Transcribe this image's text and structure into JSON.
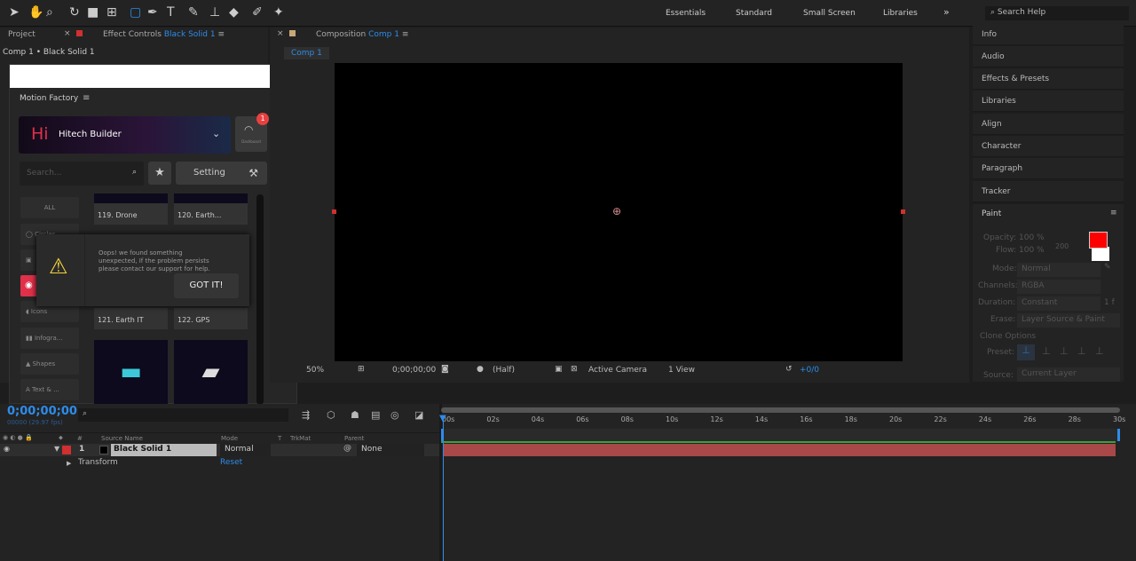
{
  "toolbar": {
    "workspaces": [
      "Essentials",
      "Standard",
      "Small Screen",
      "Libraries"
    ],
    "search_placeholder": "Search Help",
    "more": "»"
  },
  "left_panel": {
    "tab_project": "Project",
    "tab_effect_controls": "Effect Controls",
    "effect_target": "Black Solid 1",
    "breadcrumb": "Comp 1 • Black Solid 1"
  },
  "comp_panel": {
    "tab_label": "Composition",
    "comp_name": "Comp 1",
    "subtab": "Comp 1",
    "viewer_bar": {
      "zoom": "50%",
      "timecode": "0;00;00;00",
      "resolution": "(Half)",
      "camera": "Active Camera",
      "views": "1 View",
      "exposure": "+0/0"
    }
  },
  "right_panel": {
    "items": [
      "Info",
      "Audio",
      "Effects & Presets",
      "Libraries",
      "Align",
      "Character",
      "Paragraph",
      "Tracker"
    ],
    "paint": {
      "title": "Paint",
      "opacity_label": "Opacity:",
      "opacity": "100 %",
      "flow_label": "Flow:",
      "flow": "100 %",
      "brush_size": "200",
      "mode_label": "Mode:",
      "mode": "Normal",
      "channels_label": "Channels:",
      "channels": "RGBA",
      "duration_label": "Duration:",
      "duration": "Constant",
      "duration_frames": "1 f",
      "erase_label": "Erase:",
      "erase": "Layer Source & Paint",
      "clone_options": "Clone Options",
      "preset_label": "Preset:",
      "source_label": "Source:",
      "source": "Current Layer",
      "foreground_color": "#ff0000",
      "background_color": "#ffffff"
    }
  },
  "motion_factory": {
    "title": "Motion Factory",
    "pack_name": "Hitech Builder",
    "pack_logo": "Hi",
    "dashboard_label": "Dashboard",
    "notification_count": "1",
    "search_placeholder": "Search...",
    "setting_label": "Setting",
    "categories": [
      "ALL",
      "Circles",
      "",
      "",
      "Icons",
      "Infogra...",
      "Shapes",
      "Text & ..."
    ],
    "cards": [
      "119. Drone",
      "120. Earth...",
      "121. Earth IT",
      "122. GPS"
    ],
    "dialog": {
      "message": "Oops! we found something unexpected, If the problem persists please contact our support for help.",
      "button": "GOT IT!"
    }
  },
  "timeline": {
    "timecode": "0;00;00;00",
    "frame_info": "00000 (29.97 fps)",
    "columns": {
      "num": "#",
      "source": "Source Name",
      "mode": "Mode",
      "t": "T",
      "trkmat": "TrkMat",
      "parent": "Parent"
    },
    "layer": {
      "num": "1",
      "name": "Black Solid 1",
      "mode": "Normal",
      "parent": "None",
      "label_color": "#d03030"
    },
    "transform": {
      "label": "Transform",
      "reset": "Reset"
    },
    "ruler": [
      "00s",
      "02s",
      "04s",
      "06s",
      "08s",
      "10s",
      "12s",
      "14s",
      "16s",
      "18s",
      "20s",
      "22s",
      "24s",
      "26s",
      "28s",
      "30s"
    ]
  }
}
